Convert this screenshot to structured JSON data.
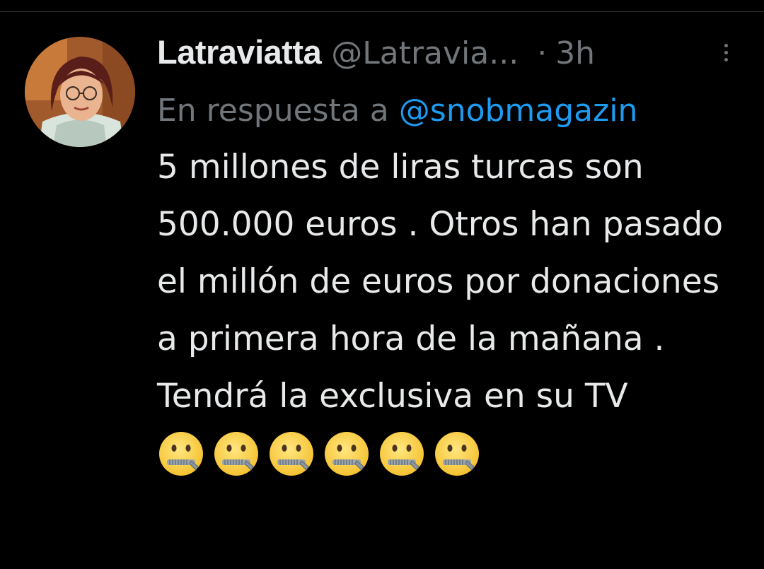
{
  "tweet": {
    "display_name": "Latraviatta",
    "handle": "@Latravia...",
    "separator": "·",
    "time": "3h",
    "more_icon": "more-vertical-icon",
    "reply_prefix": "En respuesta a",
    "reply_mention": "@snobmagazin",
    "text": "5 millones de liras turcas son 500.000 euros . Otros han pasado el millón de euros por donaciones a primera hora de la mañana . Tendrá la exclusiva en su TV",
    "emojis": [
      "zipper-mouth-face",
      "zipper-mouth-face",
      "zipper-mouth-face",
      "zipper-mouth-face",
      "zipper-mouth-face",
      "zipper-mouth-face"
    ]
  },
  "colors": {
    "background": "#000000",
    "text_primary": "#e7e9ea",
    "text_secondary": "#71767b",
    "link": "#1d9bf0",
    "divider": "#2f3336"
  }
}
